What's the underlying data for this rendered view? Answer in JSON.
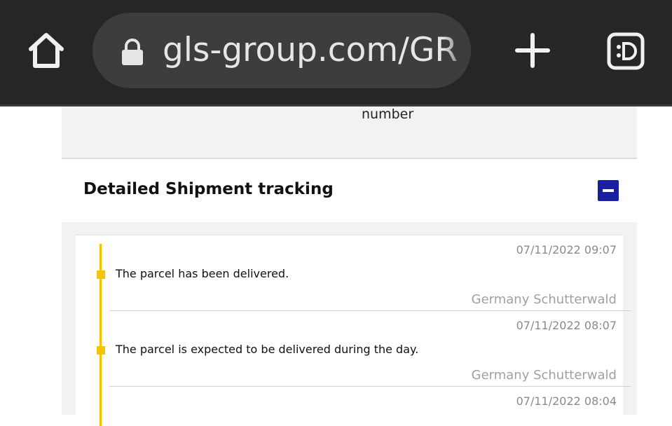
{
  "browser": {
    "url": "gls-group.com/GR("
  },
  "page": {
    "number_label": "number",
    "section_title": "Detailed Shipment tracking",
    "events": [
      {
        "time": "07/11/2022 09:07",
        "description": "The parcel has been delivered.",
        "location": "Germany Schutterwald"
      },
      {
        "time": "07/11/2022 08:07",
        "description": "The parcel is expected to be delivered during the day.",
        "location": "Germany Schutterwald"
      },
      {
        "time": "07/11/2022 08:04"
      }
    ]
  }
}
